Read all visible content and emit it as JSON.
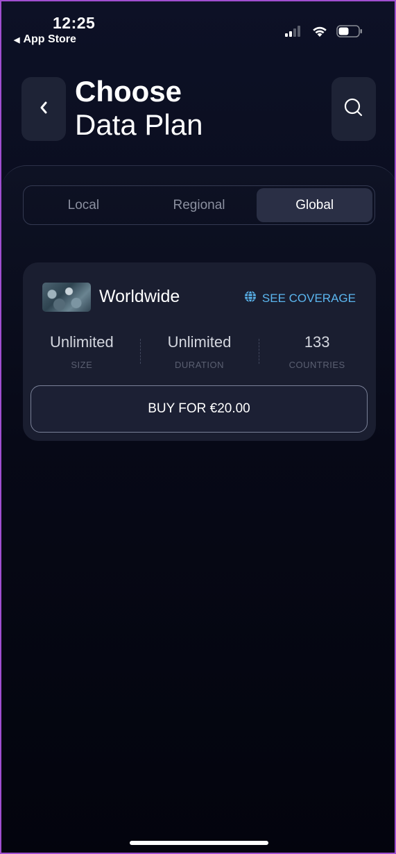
{
  "status_bar": {
    "time": "12:25",
    "back_app": "App Store",
    "cellular_icon": "cellular-signal-icon",
    "wifi_icon": "wifi-icon",
    "battery_icon": "battery-icon"
  },
  "header": {
    "title_bold": "Choose",
    "title_light": "Data Plan",
    "back_icon": "chevron-left-icon",
    "search_icon": "search-icon"
  },
  "tabs": {
    "items": [
      {
        "label": "Local"
      },
      {
        "label": "Regional"
      },
      {
        "label": "Global"
      }
    ],
    "selected": "Global"
  },
  "plan": {
    "name": "Worldwide",
    "coverage_link": "SEE COVERAGE",
    "coverage_icon": "globe-icon",
    "stats": [
      {
        "value": "Unlimited",
        "label": "SIZE"
      },
      {
        "value": "Unlimited",
        "label": "DURATION"
      },
      {
        "value": "133",
        "label": "COUNTRIES"
      }
    ],
    "buy_label": "BUY FOR €20.00"
  },
  "colors": {
    "accent": "#5bb6ef",
    "card_bg": "#1a1e30",
    "background": "#0a0d1e"
  }
}
